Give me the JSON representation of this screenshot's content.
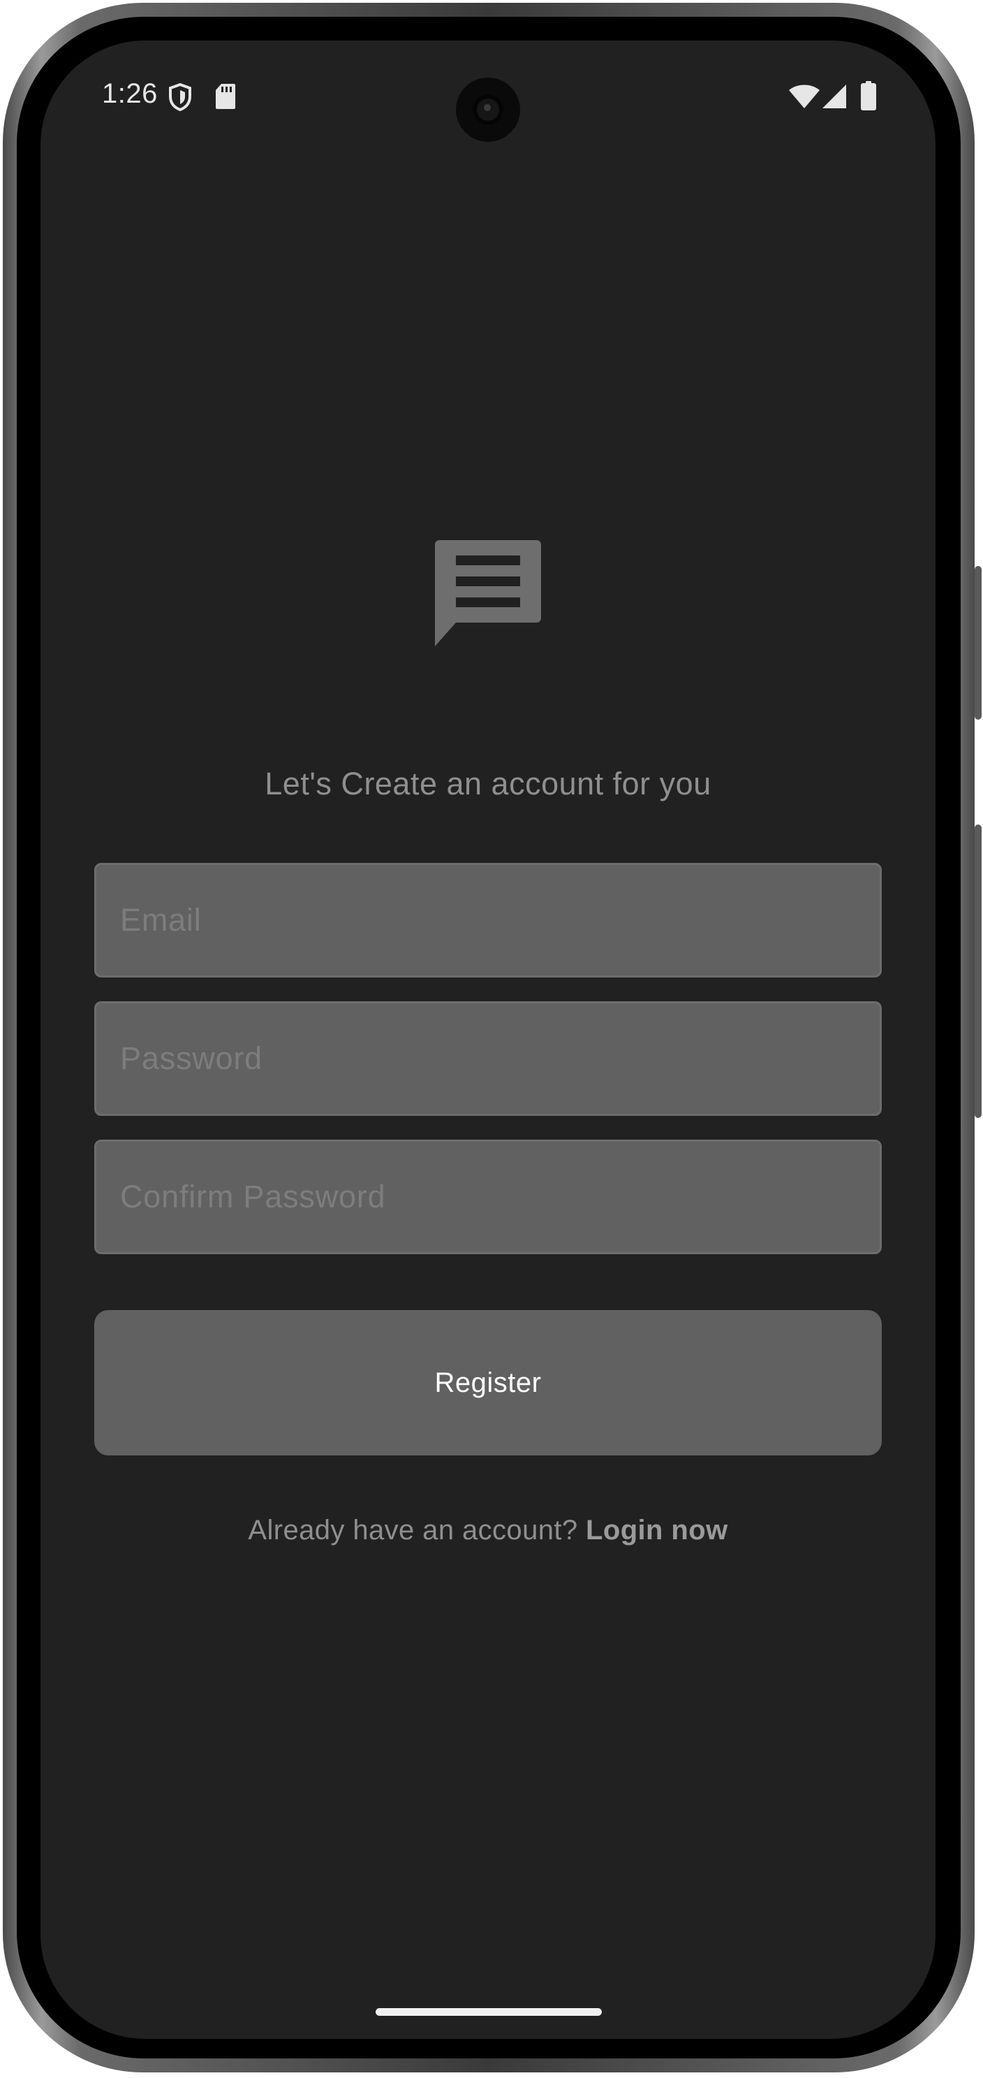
{
  "status_bar": {
    "time": "1:26",
    "icons": [
      "shield-icon",
      "sd-card-icon",
      "wifi-icon",
      "cellular-signal-icon",
      "battery-icon"
    ]
  },
  "app": {
    "logo_icon": "message-icon",
    "subtitle": "Let's Create an account for you"
  },
  "form": {
    "email_placeholder": "Email",
    "password_placeholder": "Password",
    "confirm_password_placeholder": "Confirm Password",
    "register_label": "Register"
  },
  "footer": {
    "prompt": "Already have an account?",
    "login_link": "Login now"
  },
  "colors": {
    "background": "#212121",
    "field": "#616161",
    "muted_text": "#8f8f8f",
    "placeholder": "#7d7d7d"
  }
}
